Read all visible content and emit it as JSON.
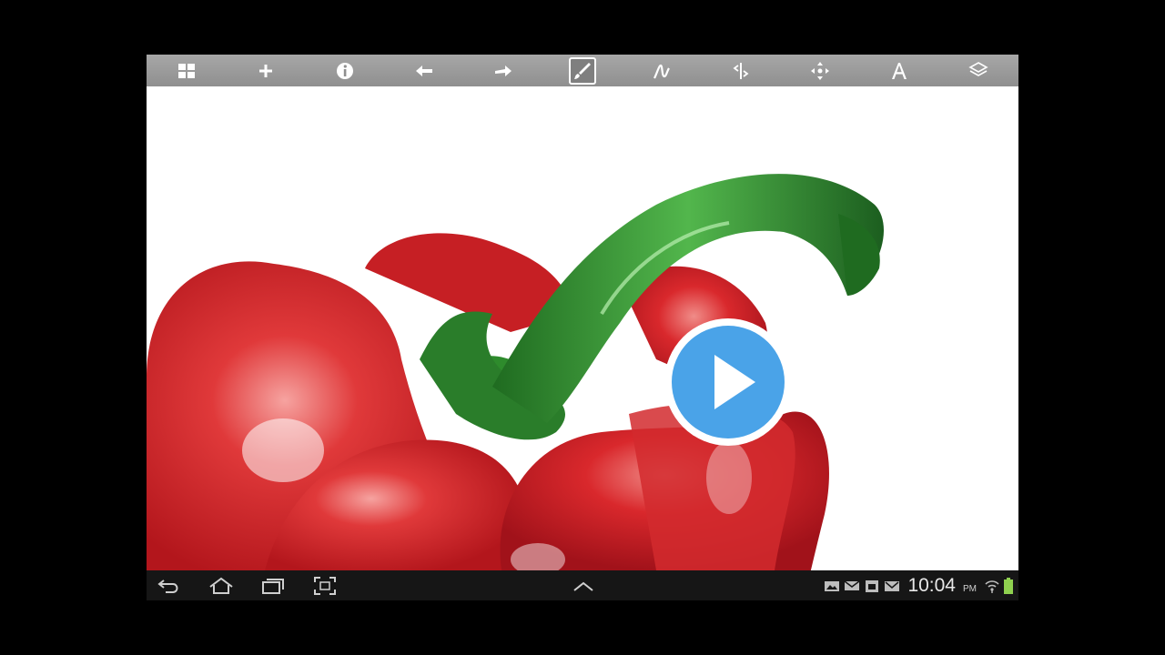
{
  "toolbar": {
    "tools": [
      "gallery-icon",
      "new-icon",
      "info-icon",
      "undo-icon",
      "redo-icon",
      "brush-icon",
      "stroke-icon",
      "symmetry-icon",
      "transform-icon",
      "text-icon",
      "layers-icon"
    ],
    "active_tool": "brush-icon"
  },
  "canvas": {
    "colors": {
      "pepper": "#d8262a",
      "stem": "#2e8b2c",
      "background": "#ffffff"
    }
  },
  "video": {
    "play_icon": "play-icon",
    "accent": "#4aa3e8"
  },
  "navbar": {
    "buttons": [
      "back-icon",
      "home-icon",
      "recent-apps-icon",
      "screenshot-icon",
      "up-arrow-icon"
    ]
  },
  "status": {
    "icons": [
      "gallery-notification-icon",
      "mail-notification-icon",
      "calendar-notification-icon",
      "email-notification-icon",
      "wifi-icon",
      "battery-icon"
    ],
    "time": "10:04",
    "ampm": "PM",
    "battery_color": "#8fd14f"
  }
}
